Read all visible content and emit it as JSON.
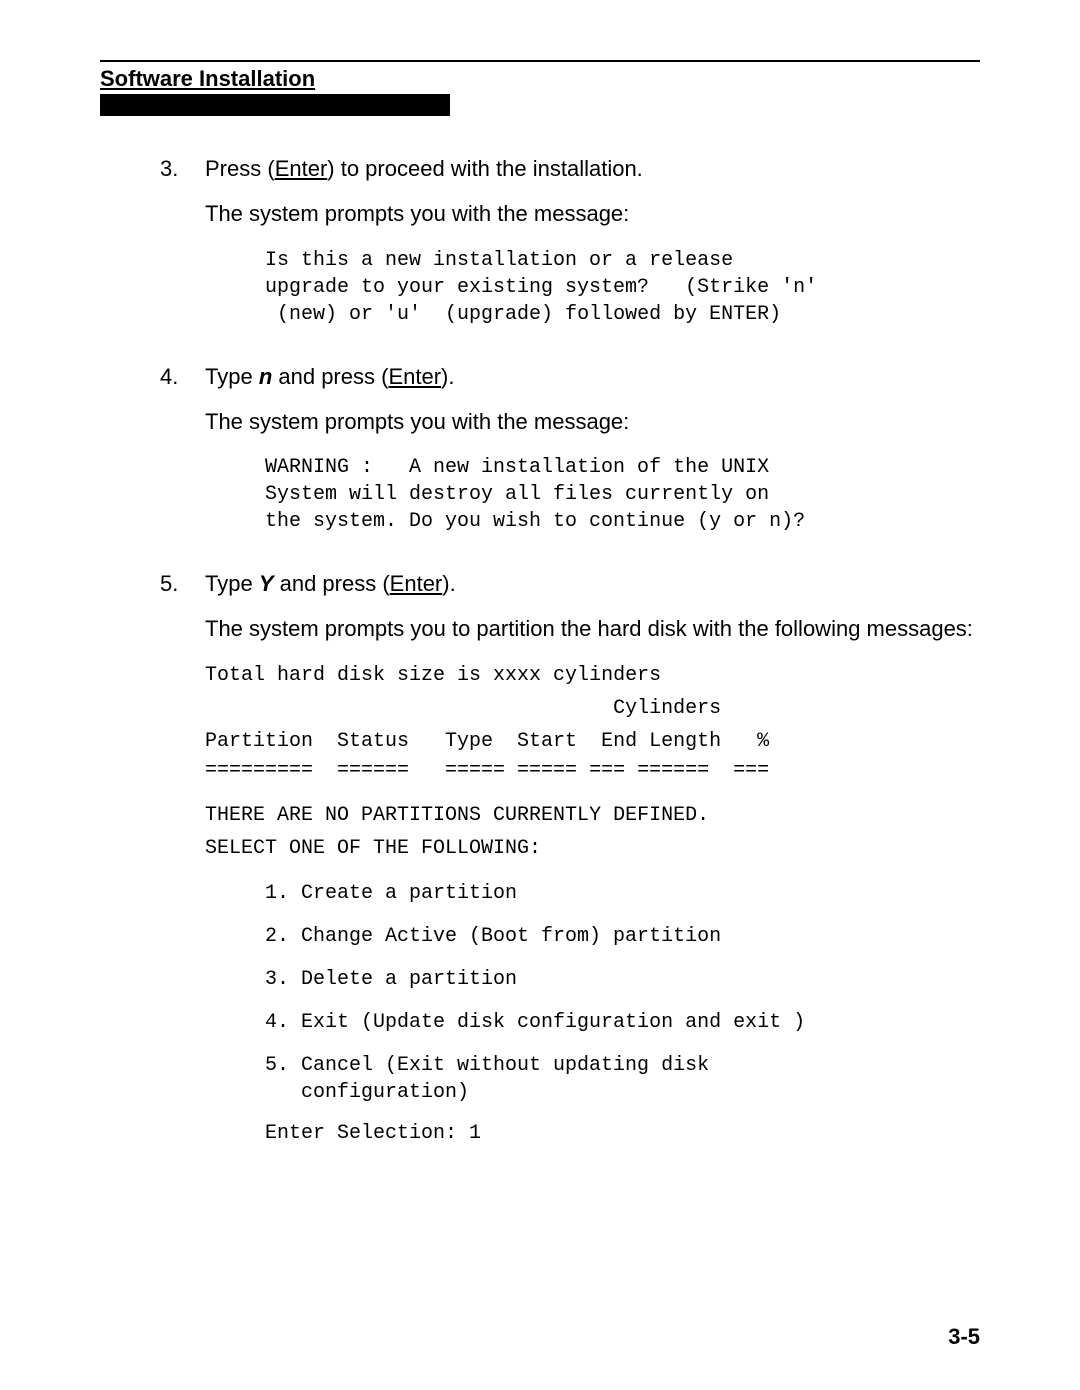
{
  "header": {
    "title": "Software Installation"
  },
  "steps": [
    {
      "num": "3.",
      "instruction_pre": "Press (",
      "instruction_key": "Enter",
      "instruction_post": ") to proceed with the installation.",
      "narrative": "The system prompts you with the message:",
      "mono": "Is this a new installation or a release\nupgrade to your existing system?   (Strike 'n'\n (new) or 'u'  (upgrade) followed by ENTER)"
    },
    {
      "num": "4.",
      "instruction_pre": "Type ",
      "instruction_bold": "n",
      "instruction_mid": " and press (",
      "instruction_key": "Enter",
      "instruction_post": ").",
      "narrative": "The system prompts you with the message:",
      "mono": "WARNING :   A new installation of the UNIX\nSystem will destroy all files currently on\nthe system. Do you wish to continue (y or n)?"
    },
    {
      "num": "5.",
      "instruction_pre": "Type ",
      "instruction_bold": "Y",
      "instruction_mid": " and press (",
      "instruction_key": "Enter",
      "instruction_post": ").",
      "narrative": "The system prompts you to partition the hard disk with the following messages:"
    }
  ],
  "disk_block": {
    "line1": "Total hard disk size is xxxx cylinders",
    "line2": "                                  Cylinders",
    "headers": "Partition  Status   Type  Start  End Length   %",
    "divider": "=========  ======   ===== ===== === ======  ===",
    "empty1": "THERE ARE NO PARTITIONS CURRENTLY DEFINED.",
    "empty2": "SELECT ONE OF THE FOLLOWING:"
  },
  "menu": [
    "1. Create a partition",
    "2. Change Active (Boot from) partition",
    "3. Delete a partition",
    "4. Exit (Update disk configuration and exit )",
    "5. Cancel (Exit without updating disk\n   configuration)"
  ],
  "enter_selection": "Enter Selection: 1",
  "page_number": "3-5"
}
